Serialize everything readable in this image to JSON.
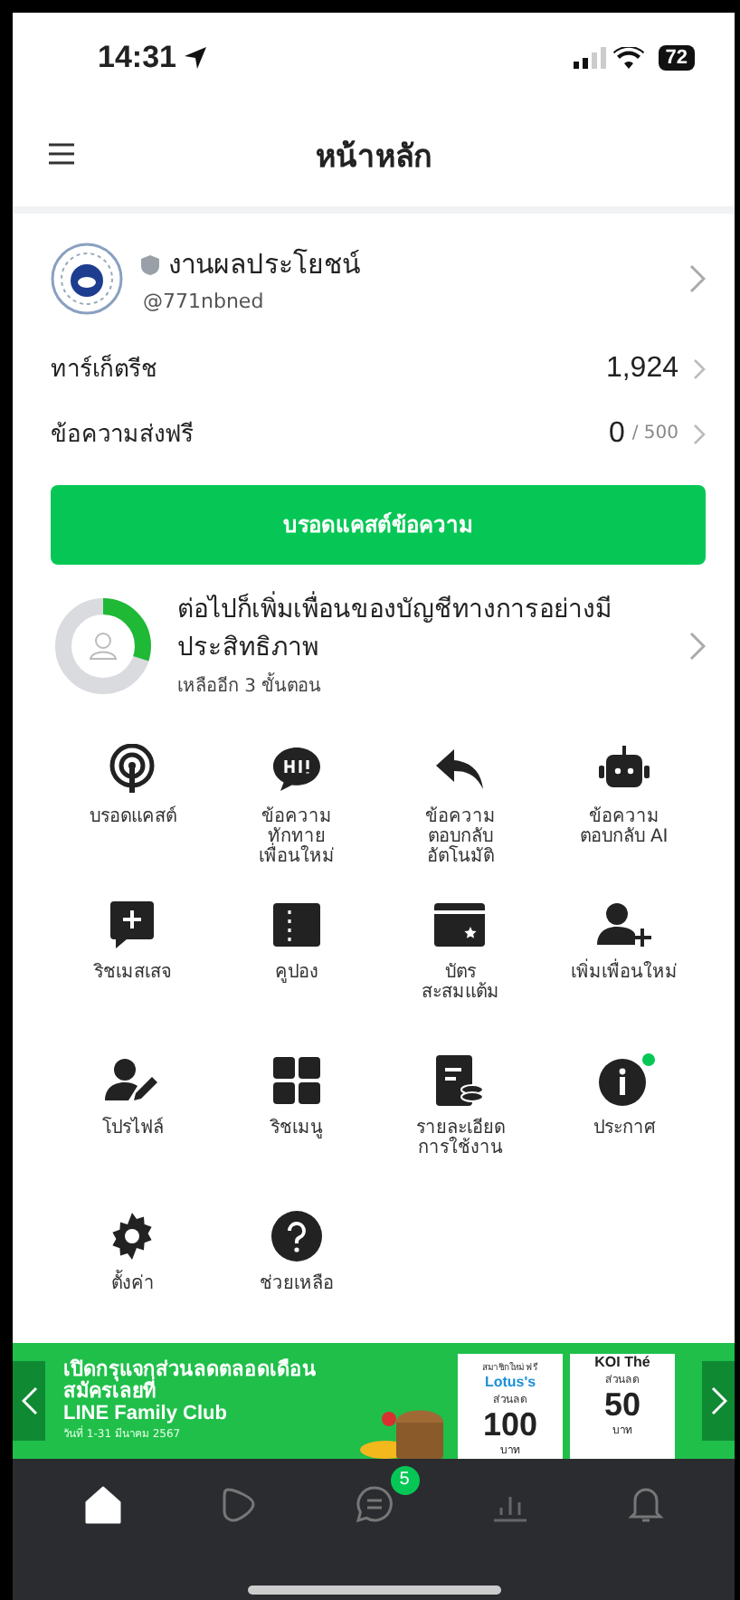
{
  "status_bar": {
    "time": "14:31",
    "battery": "72"
  },
  "header": {
    "title": "หน้าหลัก"
  },
  "account": {
    "name": "งานผลประโยชน์",
    "id": "@771nbned"
  },
  "stats": [
    {
      "label": "ทาร์เก็ตรีช",
      "value": "1,924"
    },
    {
      "label": "ข้อความส่งฟรี",
      "value": "0",
      "total": "/ 500"
    }
  ],
  "broadcast_button": "บรอดแคสต์ข้อความ",
  "progress": {
    "title": "ต่อไปก็เพิ่มเพื่อนของบัญชีทางการอย่างมีประสิทธิภาพ",
    "subtitle": "เหลืออีก 3 ขั้นตอน",
    "level": 0.3
  },
  "menu": [
    {
      "kind": "broadcast",
      "label": "บรอดแคสต์",
      "has_update": false
    },
    {
      "kind": "greeting",
      "label": "ข้อความ\nทักทาย\nเพื่อนใหม่",
      "has_update": false
    },
    {
      "kind": "reply",
      "label": "ข้อความ\nตอบกลับ\nอัตโนมัติ",
      "has_update": false
    },
    {
      "kind": "robot",
      "label": "ข้อความ\nตอบกลับ AI",
      "has_update": false
    },
    {
      "kind": "message",
      "label": "ริชเมสเสจ",
      "has_update": false
    },
    {
      "kind": "coupon",
      "label": "คูปอง",
      "has_update": false
    },
    {
      "kind": "card",
      "label": "บัตร\nสะสมแต้ม",
      "has_update": false
    },
    {
      "kind": "add_friend",
      "label": "เพิ่มเพื่อนใหม่",
      "has_update": false
    },
    {
      "kind": "profile",
      "label": "โปรไฟล์",
      "has_update": false
    },
    {
      "kind": "grid",
      "label": "ริชเมนู",
      "has_update": false
    },
    {
      "kind": "usage",
      "label": "รายละเอียด\nการใช้งาน",
      "has_update": false
    },
    {
      "kind": "info",
      "label": "ประกาศ",
      "has_update": true
    },
    {
      "kind": "gear",
      "label": "ตั้งค่า",
      "has_update": false
    },
    {
      "kind": "help",
      "label": "ช่วยเหลือ",
      "has_update": false
    }
  ],
  "banner": {
    "lines": [
      "เปิดกรุแจกส่วนลดตลอดเดือน",
      "สมัครเลยที่",
      "LINE Family Club"
    ],
    "date": "วันที่ 1-31 มีนาคม 2567",
    "cards": [
      {
        "top": "สมาชิกใหม่ ฟรี",
        "brand": "Lotus's",
        "caption": "ส่วนลด",
        "amount": "100",
        "unit": "บาท"
      },
      {
        "brand": "KOI Thé",
        "caption": "ส่วนลด",
        "amount": "50",
        "unit": "บาท"
      }
    ]
  },
  "tab_bar": [
    {
      "kind": "home",
      "selected": true
    },
    {
      "kind": "play",
      "selected": false
    },
    {
      "kind": "chat",
      "selected": false,
      "badge": "5"
    },
    {
      "kind": "chart",
      "selected": false
    },
    {
      "kind": "bell",
      "selected": false
    }
  ]
}
